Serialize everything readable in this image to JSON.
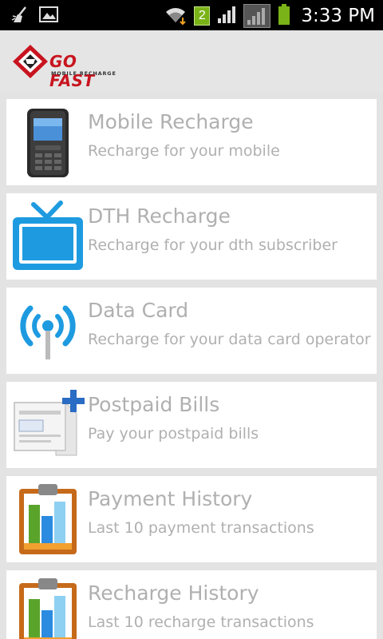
{
  "status_bar": {
    "time": "3:33 PM",
    "sim_number": "2",
    "icons": [
      "broom-icon",
      "gallery-icon",
      "wifi-icon",
      "sim-icon",
      "signal-icon",
      "signal-roaming-icon",
      "battery-icon"
    ]
  },
  "header": {
    "logo_title": "GO FAST",
    "logo_subtitle": "MOBILE RECHARGE",
    "brand_color": "#c8141f"
  },
  "menu": {
    "items": [
      {
        "title": "Mobile Recharge",
        "subtitle": "Recharge for your mobile",
        "icon": "mobile-phone-icon"
      },
      {
        "title": "DTH Recharge",
        "subtitle": "Recharge for your dth subscriber",
        "icon": "tv-icon"
      },
      {
        "title": "Data Card",
        "subtitle": "Recharge for your data card operator",
        "icon": "wireless-signal-icon"
      },
      {
        "title": "Postpaid Bills",
        "subtitle": "Pay your postpaid bills",
        "icon": "bill-icon"
      },
      {
        "title": "Payment History",
        "subtitle": "Last 10 payment transactions",
        "icon": "clipboard-chart-icon"
      },
      {
        "title": "Recharge History",
        "subtitle": "Last 10 recharge transactions",
        "icon": "clipboard-chart-icon"
      }
    ]
  },
  "colors": {
    "background": "#e3e3e3",
    "card": "#ffffff",
    "text_muted": "#b0b0b0",
    "accent_blue": "#1e9be0"
  }
}
